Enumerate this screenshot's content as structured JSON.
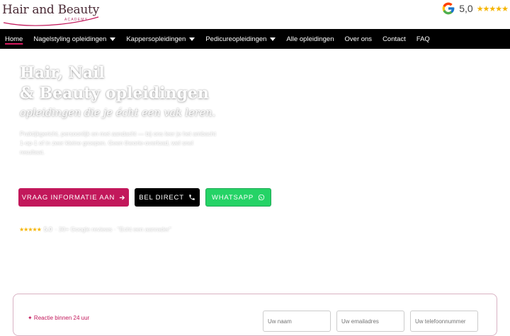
{
  "header": {
    "logo_text": "Hair and Beauty",
    "logo_subtext": "ACADEMY",
    "google_rating": "5,0",
    "google_stars": "★★★★★",
    "google_icon": "google-g-icon"
  },
  "nav": {
    "items": [
      {
        "label": "Home",
        "active": true,
        "dropdown": false
      },
      {
        "label": "Nagelstyling opleidingen",
        "dropdown": true
      },
      {
        "label": "Kappersopleidingen",
        "dropdown": true
      },
      {
        "label": "Pedicureopleidingen",
        "dropdown": true
      },
      {
        "label": "Alle opleidingen",
        "dropdown": false
      },
      {
        "label": "Over ons",
        "dropdown": false
      },
      {
        "label": "Contact",
        "dropdown": false
      },
      {
        "label": "FAQ",
        "dropdown": false
      }
    ]
  },
  "hero": {
    "title_line1": "Hair, Nail",
    "title_line2": "& Beauty opleidingen",
    "subtitle": "opleidingen die je écht een vak leren.",
    "text": "Praktijkgericht, persoonlijk en met aandacht — bij ons leer je het ambacht 1-op-1 of in zeer kleine groepen. Geen theorie-overload, wel snel resultaat.",
    "buttons": {
      "info": "VRAAG INFORMATIE AAN",
      "call": "BEL DIRECT",
      "whatsapp": "WHATSAPP"
    },
    "reviews": {
      "stars": "★★★★★",
      "score": "5.0",
      "text": "· 30+ Google reviews · \"Echt een aanrader\""
    }
  },
  "form": {
    "note": "✦ Reactie binnen 24 uur",
    "name_placeholder": "Uw naam",
    "email_placeholder": "Uw emailadres",
    "phone_placeholder": "Uw telefoonnummer"
  },
  "colors": {
    "accent": "#c2185b",
    "nav_bg": "#000000",
    "whatsapp": "#25d366",
    "star": "#f5b400"
  }
}
